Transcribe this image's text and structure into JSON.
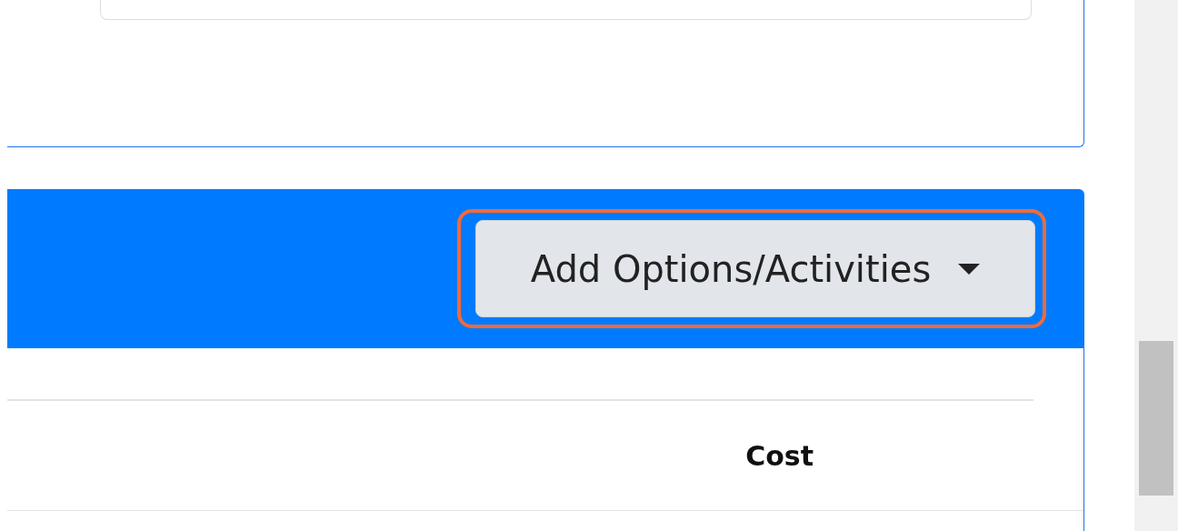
{
  "options_bar": {
    "button": {
      "label": "Add Options/Activities",
      "highlighted": true
    }
  },
  "table": {
    "columns": [
      {
        "label": "Cost"
      }
    ]
  }
}
